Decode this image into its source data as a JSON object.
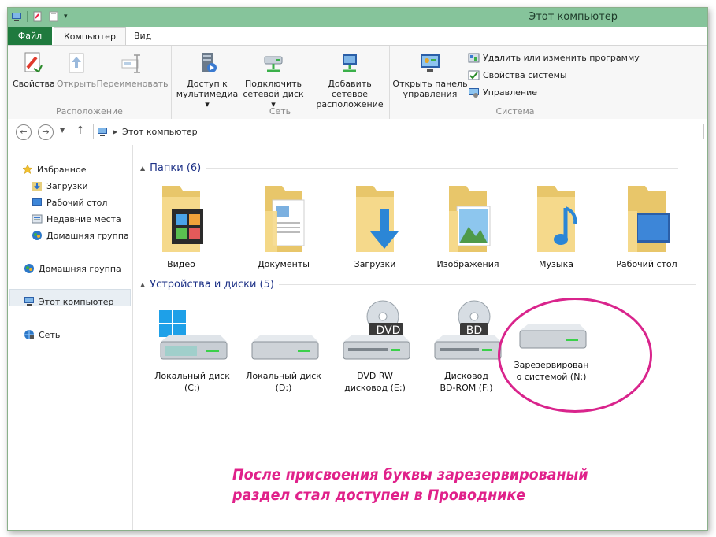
{
  "window": {
    "title": "Этот компьютер"
  },
  "tabs": {
    "file": "Файл",
    "computer": "Компьютер",
    "view": "Вид"
  },
  "ribbon": {
    "location": {
      "name": "Расположение",
      "buttons": [
        "Свойства",
        "Открыть",
        "Переименовать"
      ]
    },
    "network": {
      "name": "Сеть",
      "media_l1": "Доступ к",
      "media_l2": "мультимедиа",
      "map_l1": "Подключить",
      "map_l2": "сетевой диск",
      "add_l1": "Добавить сетевое",
      "add_l2": "расположение"
    },
    "system": {
      "name": "Система",
      "cp_l1": "Открыть панель",
      "cp_l2": "управления",
      "uninstall": "Удалить или изменить программу",
      "props": "Свойства системы",
      "manage": "Управление"
    }
  },
  "address": {
    "path": "Этот компьютер"
  },
  "nav": {
    "favorites": "Избранное",
    "downloads": "Загрузки",
    "desktop": "Рабочий стол",
    "recent": "Недавние места",
    "homegroup_fav": "Домашняя группа",
    "homegroup": "Домашняя группа",
    "computer": "Этот компьютер",
    "network": "Сеть"
  },
  "folders": {
    "header": "Папки (6)",
    "items": [
      "Видео",
      "Документы",
      "Загрузки",
      "Изображения",
      "Музыка",
      "Рабочий стол"
    ]
  },
  "devices": {
    "header": "Устройства и диски (5)",
    "c_l1": "Локальный диск",
    "c_l2": "(C:)",
    "d_l1": "Локальный диск",
    "d_l2": "(D:)",
    "e_l1": "DVD RW",
    "e_l2": "дисковод (E:)",
    "f_l1": "Дисковод",
    "f_l2": "BD-ROM (F:)",
    "n_l1": "Зарезервирован",
    "n_l2": "о системой (N:)",
    "dvd_badge": "DVD",
    "bd_badge": "BD"
  },
  "annotation": {
    "line1": "После присвоения буквы зарезервированый",
    "line2": "раздел стал доступен в Проводнике"
  }
}
